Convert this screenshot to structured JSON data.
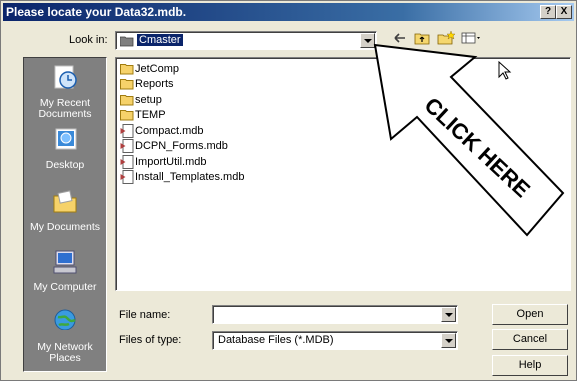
{
  "title": "Please locate your Data32.mdb.",
  "title_buttons": {
    "help": "?",
    "close": "X"
  },
  "look_in": {
    "label": "Look in:",
    "value": "Cmaster"
  },
  "places": [
    {
      "label": "My Recent Documents",
      "icon": "clock-icon"
    },
    {
      "label": "Desktop",
      "icon": "desktop-icon"
    },
    {
      "label": "My Documents",
      "icon": "folder-icon"
    },
    {
      "label": "My Computer",
      "icon": "computer-icon"
    },
    {
      "label": "My Network Places",
      "icon": "globe-icon"
    }
  ],
  "files": [
    {
      "name": "JetComp",
      "type": "folder"
    },
    {
      "name": "Reports",
      "type": "folder"
    },
    {
      "name": "setup",
      "type": "folder"
    },
    {
      "name": "TEMP",
      "type": "folder"
    },
    {
      "name": "Compact.mdb",
      "type": "mdb"
    },
    {
      "name": "DCPN_Forms.mdb",
      "type": "mdb"
    },
    {
      "name": "ImportUtil.mdb",
      "type": "mdb"
    },
    {
      "name": "Install_Templates.mdb",
      "type": "mdb"
    }
  ],
  "annotation": "CLICK HERE",
  "file_name": {
    "label": "File name:",
    "value": ""
  },
  "file_type": {
    "label": "Files of type:",
    "value": "Database Files (*.MDB)"
  },
  "buttons": {
    "open": "Open",
    "cancel": "Cancel",
    "help": "Help"
  }
}
